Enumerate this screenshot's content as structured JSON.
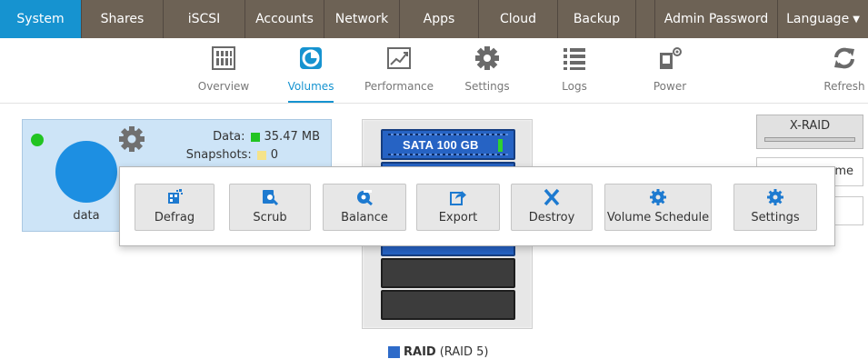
{
  "nav": {
    "tabs": [
      {
        "label": "System",
        "active": true
      },
      {
        "label": "Shares"
      },
      {
        "label": "iSCSI"
      },
      {
        "label": "Accounts"
      },
      {
        "label": "Network"
      },
      {
        "label": "Apps"
      },
      {
        "label": "Cloud"
      },
      {
        "label": "Backup"
      },
      {
        "label": ""
      },
      {
        "label": "Admin Password"
      },
      {
        "label": "Language"
      }
    ],
    "language_caret": "▼"
  },
  "subnav": {
    "items": [
      {
        "label": "Overview",
        "icon": "overview-icon"
      },
      {
        "label": "Volumes",
        "icon": "volumes-icon",
        "active": true
      },
      {
        "label": "Performance",
        "icon": "performance-icon"
      },
      {
        "label": "Settings",
        "icon": "settings-icon"
      },
      {
        "label": "Logs",
        "icon": "logs-icon"
      },
      {
        "label": "Power",
        "icon": "power-icon"
      },
      {
        "label": "Refresh",
        "icon": "refresh-icon"
      }
    ]
  },
  "volume": {
    "name": "data",
    "status_color": "#22c422",
    "data_label": "Data:",
    "data_value": "35.47 MB",
    "data_color": "#22c422",
    "snapshots_label": "Snapshots:",
    "snapshots_value": "0",
    "snapshots_color": "#f5e38a"
  },
  "enclosure": {
    "disk_label": "SATA 100 GB",
    "raid_name": "RAID",
    "raid_level": "(RAID 5)",
    "raid_color": "#2e6bc9"
  },
  "right_panel": {
    "xraid_label": "X-RAID",
    "partial_button_text": "me"
  },
  "popup_menu": {
    "items": [
      {
        "label": "Defrag",
        "icon": "defrag-icon"
      },
      {
        "label": "Scrub",
        "icon": "scrub-icon"
      },
      {
        "label": "Balance",
        "icon": "balance-icon"
      },
      {
        "label": "Export",
        "icon": "export-icon"
      },
      {
        "label": "Destroy",
        "icon": "destroy-icon"
      },
      {
        "label": "Volume Schedule",
        "icon": "volume-schedule-icon"
      },
      {
        "label": "Settings",
        "icon": "settings-icon"
      }
    ]
  },
  "colors": {
    "nav_bg": "#6d6255",
    "accent": "#1693d0",
    "volume_blue": "#1d8fe2",
    "card_bg": "#cde4f7"
  }
}
